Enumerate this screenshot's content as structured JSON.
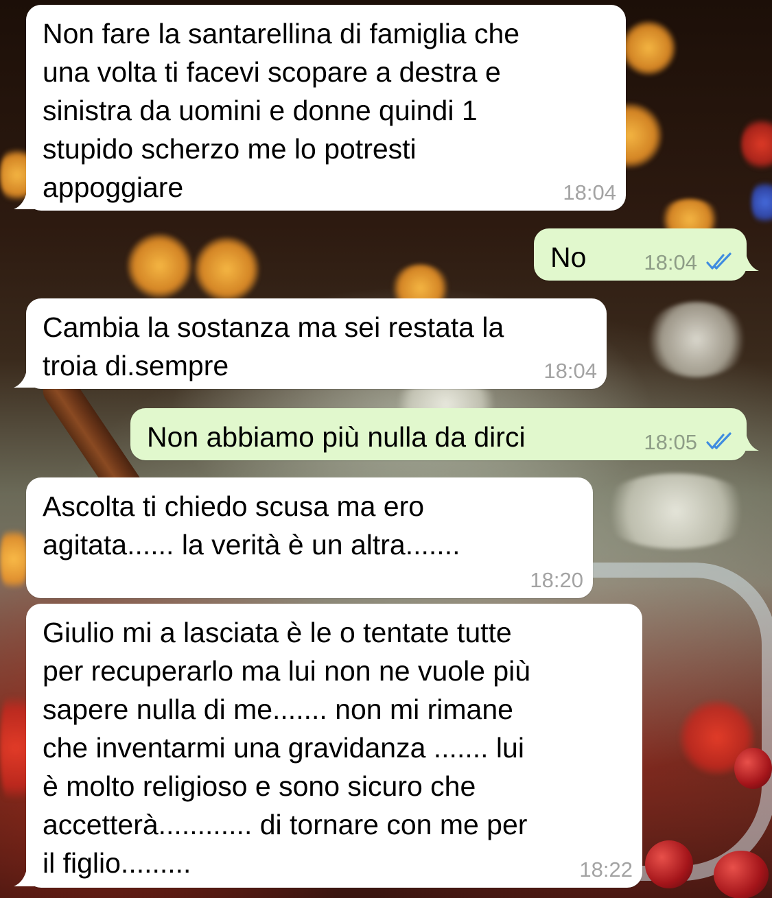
{
  "messages": [
    {
      "direction": "incoming",
      "text": "Non fare la santarellina di famiglia che\nuna volta ti facevi scopare a destra e\nsinistra da uomini e donne quindi 1\nstupido scherzo me lo potresti\nappoggiare",
      "time": "18:04"
    },
    {
      "direction": "outgoing",
      "text": "No",
      "time": "18:04",
      "status": "read"
    },
    {
      "direction": "incoming",
      "text": "Cambia la sostanza ma sei restata la\ntroia di.sempre",
      "time": "18:04"
    },
    {
      "direction": "outgoing",
      "text": "Non abbiamo più nulla da dirci",
      "time": "18:05",
      "status": "read"
    },
    {
      "direction": "incoming",
      "text": "Ascolta ti chiedo scusa ma ero\nagitata...... la verità è un altra.......",
      "time": "18:20"
    },
    {
      "direction": "incoming",
      "text": "Giulio mi a lasciata è le o tentate tutte\nper recuperarlo ma lui non ne vuole più\nsapere nulla di me....... non mi rimane\nche inventarmi una gravidanza ....... lui\nè molto religioso e sono sicuro che\naccetterà............ di tornare con me per\nil figlio.........",
      "time": "18:22"
    }
  ],
  "colors": {
    "incoming_bubble": "#ffffff",
    "outgoing_bubble": "#e1f8cd",
    "read_ticks": "#3f8ce0",
    "timestamp": "#a3a3a3"
  },
  "icons": {
    "read_status": "double-check-icon"
  }
}
